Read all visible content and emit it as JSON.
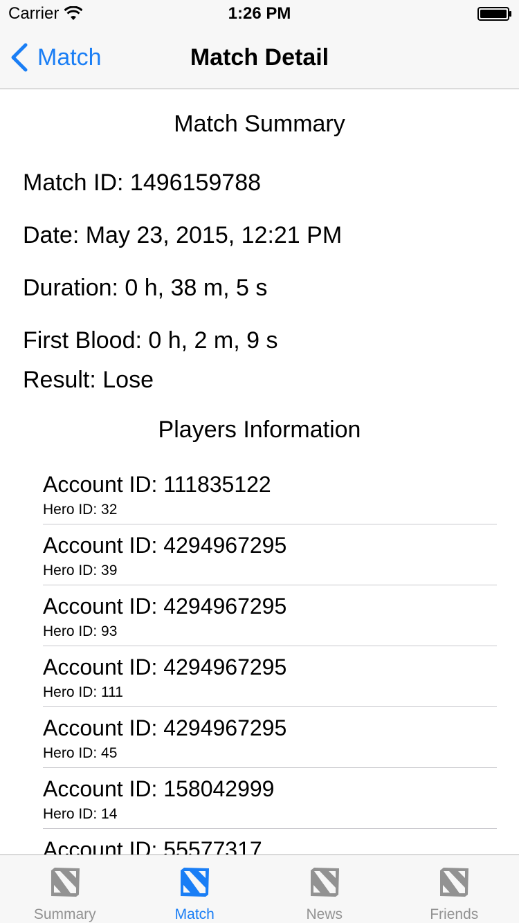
{
  "status_bar": {
    "carrier": "Carrier",
    "time": "1:26 PM"
  },
  "nav": {
    "back_label": "Match",
    "title": "Match Detail"
  },
  "summary": {
    "title": "Match Summary",
    "match_id": "Match ID: 1496159788",
    "date": "Date: May 23, 2015, 12:21 PM",
    "duration": "Duration: 0 h, 38 m, 5 s",
    "first_blood": "First Blood: 0 h, 2 m, 9 s",
    "result": "Result: Lose"
  },
  "players": {
    "title": "Players Information",
    "items": [
      {
        "account": "Account ID: 111835122",
        "hero": "Hero ID: 32"
      },
      {
        "account": "Account ID: 4294967295",
        "hero": "Hero ID: 39"
      },
      {
        "account": "Account ID: 4294967295",
        "hero": "Hero ID: 93"
      },
      {
        "account": "Account ID: 4294967295",
        "hero": "Hero ID: 111"
      },
      {
        "account": "Account ID: 4294967295",
        "hero": "Hero ID: 45"
      },
      {
        "account": "Account ID: 158042999",
        "hero": "Hero ID: 14"
      },
      {
        "account": "Account ID: 55577317",
        "hero": ""
      }
    ]
  },
  "tabs": [
    {
      "label": "Summary",
      "icon": "dota-logo-icon",
      "active": false
    },
    {
      "label": "Match",
      "icon": "dota-logo-icon",
      "active": true
    },
    {
      "label": "News",
      "icon": "dota-logo-icon",
      "active": false
    },
    {
      "label": "Friends",
      "icon": "dota-logo-icon",
      "active": false
    }
  ],
  "colors": {
    "accent": "#1a7ef5",
    "inactive": "#929292",
    "bar_background": "#f7f7f7",
    "separator": "#c8c7cc"
  }
}
